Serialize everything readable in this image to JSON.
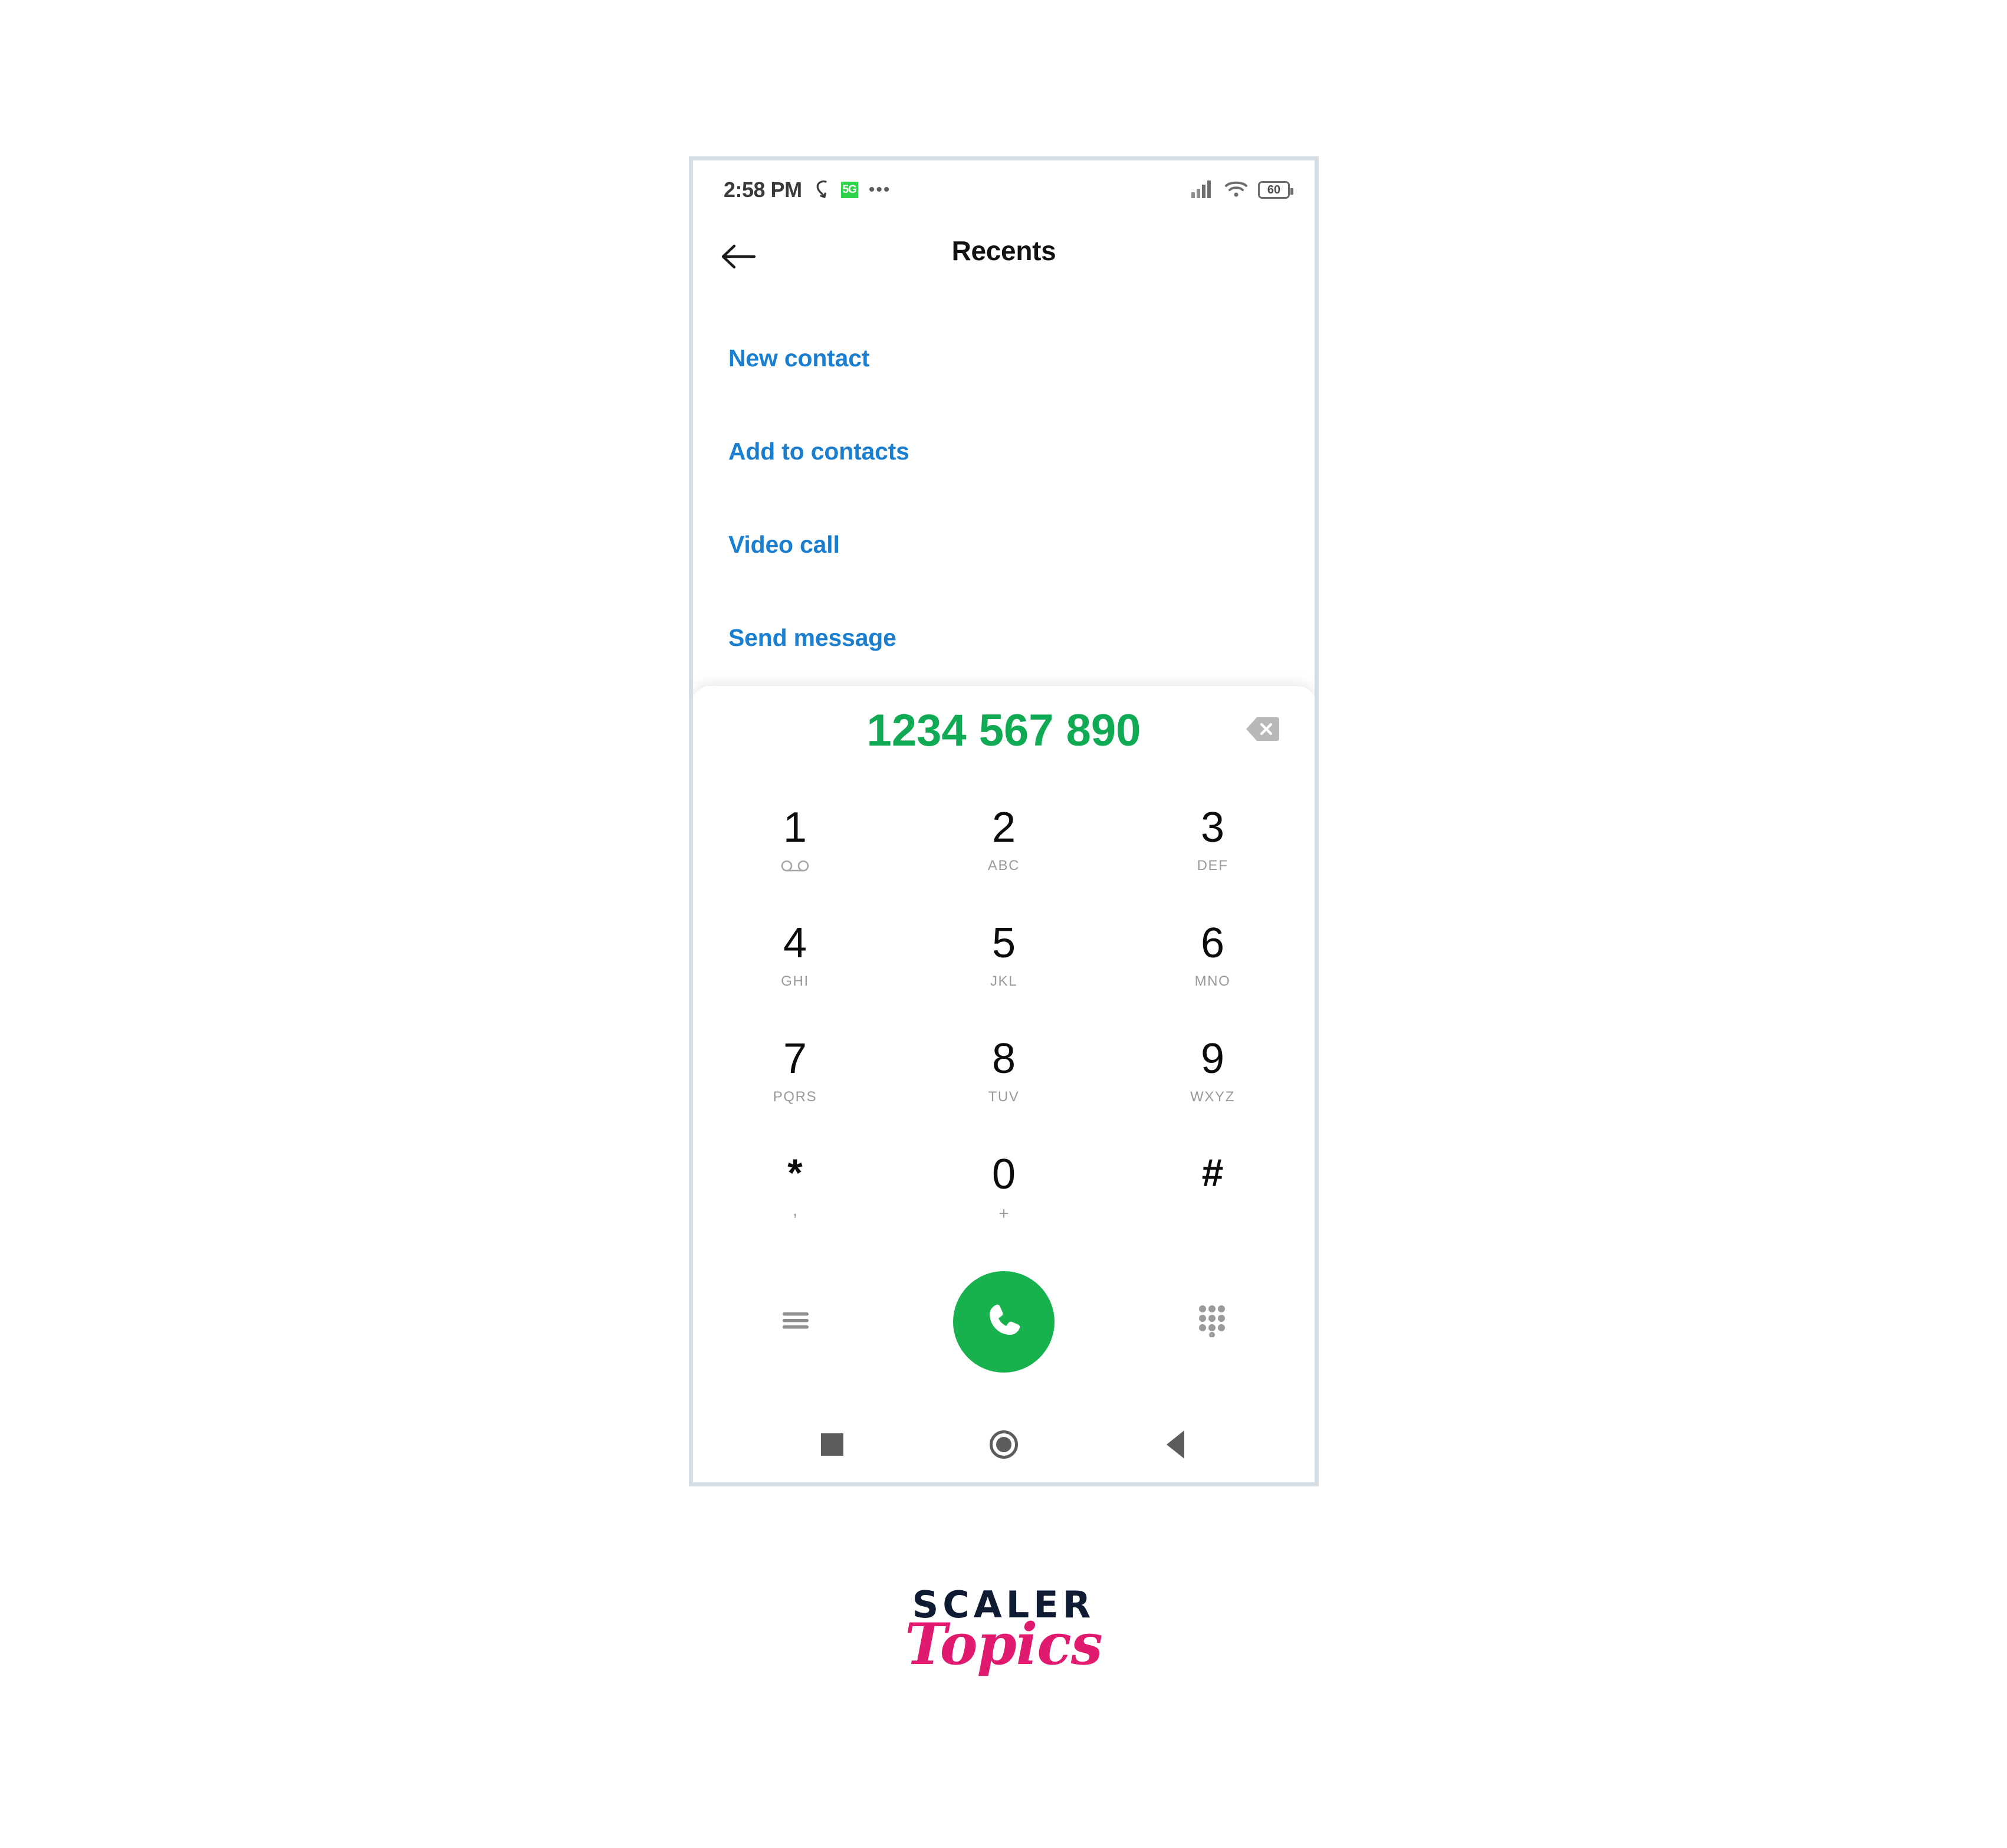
{
  "status_bar": {
    "time": "2:58 PM",
    "vibrate_icon": "vibrate-icon",
    "network_badge": "5G",
    "more_dots": "•••",
    "signal_icon": "signal-bars-icon",
    "wifi_icon": "wifi-icon",
    "battery_level": "60"
  },
  "app_bar": {
    "back_icon": "arrow-left-icon",
    "title": "Recents"
  },
  "menu": {
    "items": [
      {
        "label": "New contact"
      },
      {
        "label": "Add to contacts"
      },
      {
        "label": "Video call"
      },
      {
        "label": "Send message"
      }
    ]
  },
  "dialpad": {
    "dialed_number": "1234 567 890",
    "backspace_icon": "backspace-icon",
    "keys": [
      {
        "digit": "1",
        "sub": "",
        "sub_icon": "voicemail-icon"
      },
      {
        "digit": "2",
        "sub": "ABC",
        "sub_icon": ""
      },
      {
        "digit": "3",
        "sub": "DEF",
        "sub_icon": ""
      },
      {
        "digit": "4",
        "sub": "GHI",
        "sub_icon": ""
      },
      {
        "digit": "5",
        "sub": "JKL",
        "sub_icon": ""
      },
      {
        "digit": "6",
        "sub": "MNO",
        "sub_icon": ""
      },
      {
        "digit": "7",
        "sub": "PQRS",
        "sub_icon": ""
      },
      {
        "digit": "8",
        "sub": "TUV",
        "sub_icon": ""
      },
      {
        "digit": "9",
        "sub": "WXYZ",
        "sub_icon": ""
      },
      {
        "digit": "*",
        "sub": ",",
        "sub_icon": ""
      },
      {
        "digit": "0",
        "sub": "+",
        "sub_icon": ""
      },
      {
        "digit": "#",
        "sub": "",
        "sub_icon": ""
      }
    ],
    "actions": {
      "menu_icon": "hamburger-menu-icon",
      "call_icon": "phone-handset-icon",
      "dialpad_icon": "dialpad-grid-icon"
    }
  },
  "nav_bar": {
    "recents_icon": "square-recents-icon",
    "home_icon": "circle-home-icon",
    "back_icon": "triangle-back-icon"
  },
  "branding": {
    "name": "SCALER",
    "sub_name": "Topics"
  },
  "colors": {
    "accent_green": "#17b24e",
    "number_green": "#11aa54",
    "link_blue": "#1a7fd1",
    "frame_border": "#d4dce4",
    "brand_navy": "#0f1b33",
    "brand_pink": "#e01a6f"
  }
}
